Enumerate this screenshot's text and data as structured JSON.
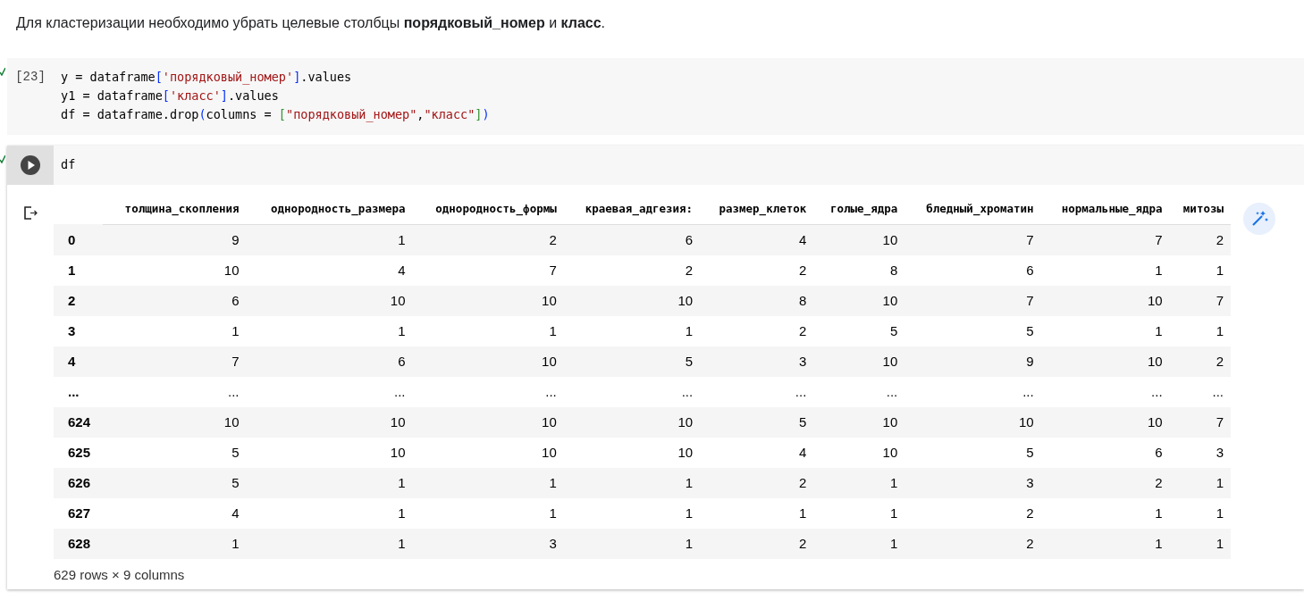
{
  "intro": "Для кластеризации необходимо убрать целевые столбцы **порядковый_номер** и **класс**.",
  "cells": [
    {
      "execution_count": "[23]",
      "done": true,
      "kind": "executed",
      "lines": [
        [
          {
            "text": "y = dataframe",
            "kind": "plain"
          },
          {
            "text": "[",
            "kind": "bracket1"
          },
          {
            "text": "'порядковый_номер'",
            "kind": "string"
          },
          {
            "text": "]",
            "kind": "bracket1"
          },
          {
            "text": ".values",
            "kind": "plain"
          }
        ],
        [
          {
            "text": "y1 = dataframe",
            "kind": "plain"
          },
          {
            "text": "[",
            "kind": "bracket1"
          },
          {
            "text": "'класс'",
            "kind": "string"
          },
          {
            "text": "]",
            "kind": "bracket1"
          },
          {
            "text": ".values",
            "kind": "plain"
          }
        ],
        [
          {
            "text": "df = dataframe.drop",
            "kind": "plain"
          },
          {
            "text": "(",
            "kind": "bracket1"
          },
          {
            "text": "columns = ",
            "kind": "plain"
          },
          {
            "text": "[",
            "kind": "bracket2"
          },
          {
            "text": "\"порядковый_номер\"",
            "kind": "string"
          },
          {
            "text": ",",
            "kind": "plain"
          },
          {
            "text": "\"класс\"",
            "kind": "string"
          },
          {
            "text": "]",
            "kind": "bracket2"
          },
          {
            "text": ")",
            "kind": "bracket1"
          }
        ]
      ]
    },
    {
      "done": true,
      "kind": "focused",
      "lines": [
        [
          {
            "text": "df",
            "kind": "plain"
          }
        ]
      ],
      "output": {
        "table": {
          "columns": [
            "толщина_скопления",
            "однородность_размера",
            "однородность_формы",
            "краевая_адгезия:",
            "размер_клеток",
            "голые_ядра",
            "бледный_хроматин",
            "нормальные_ядра",
            "митозы"
          ],
          "rows": [
            {
              "index": "0",
              "cells": [
                "9",
                "1",
                "2",
                "6",
                "4",
                "10",
                "7",
                "7",
                "2"
              ]
            },
            {
              "index": "1",
              "cells": [
                "10",
                "4",
                "7",
                "2",
                "2",
                "8",
                "6",
                "1",
                "1"
              ]
            },
            {
              "index": "2",
              "cells": [
                "6",
                "10",
                "10",
                "10",
                "8",
                "10",
                "7",
                "10",
                "7"
              ]
            },
            {
              "index": "3",
              "cells": [
                "1",
                "1",
                "1",
                "1",
                "2",
                "5",
                "5",
                "1",
                "1"
              ]
            },
            {
              "index": "4",
              "cells": [
                "7",
                "6",
                "10",
                "5",
                "3",
                "10",
                "9",
                "10",
                "2"
              ]
            },
            {
              "index": "...",
              "cells": [
                "...",
                "...",
                "...",
                "...",
                "...",
                "...",
                "...",
                "...",
                "..."
              ]
            },
            {
              "index": "624",
              "cells": [
                "10",
                "10",
                "10",
                "10",
                "5",
                "10",
                "10",
                "10",
                "7"
              ]
            },
            {
              "index": "625",
              "cells": [
                "5",
                "10",
                "10",
                "10",
                "4",
                "10",
                "5",
                "6",
                "3"
              ]
            },
            {
              "index": "626",
              "cells": [
                "5",
                "1",
                "1",
                "1",
                "2",
                "1",
                "3",
                "2",
                "1"
              ]
            },
            {
              "index": "627",
              "cells": [
                "4",
                "1",
                "1",
                "1",
                "1",
                "1",
                "2",
                "1",
                "1"
              ]
            },
            {
              "index": "628",
              "cells": [
                "1",
                "1",
                "3",
                "1",
                "2",
                "1",
                "2",
                "1",
                "1"
              ]
            }
          ]
        },
        "shape": "629 rows × 9 columns"
      }
    }
  ]
}
